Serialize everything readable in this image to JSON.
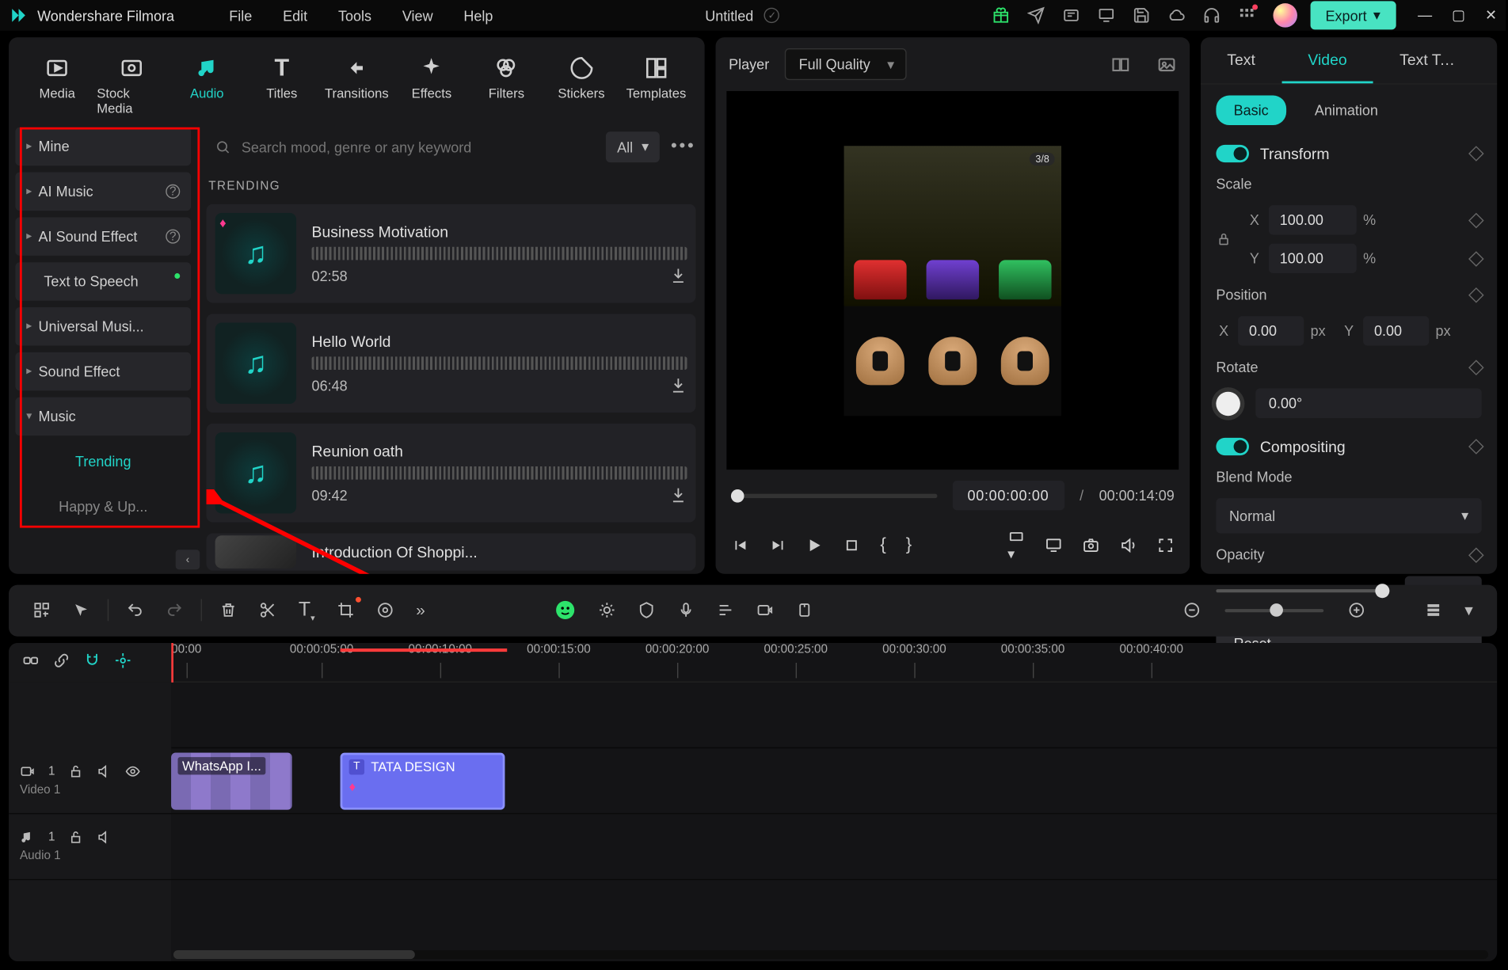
{
  "app": {
    "name": "Wondershare Filmora",
    "doc_title": "Untitled"
  },
  "menus": [
    "File",
    "Edit",
    "Tools",
    "View",
    "Help"
  ],
  "export_label": "Export",
  "media_tabs": [
    {
      "id": "media",
      "label": "Media"
    },
    {
      "id": "stock",
      "label": "Stock Media"
    },
    {
      "id": "audio",
      "label": "Audio"
    },
    {
      "id": "titles",
      "label": "Titles"
    },
    {
      "id": "trans",
      "label": "Transitions"
    },
    {
      "id": "effects",
      "label": "Effects"
    },
    {
      "id": "filters",
      "label": "Filters"
    },
    {
      "id": "stickers",
      "label": "Stickers"
    },
    {
      "id": "templates",
      "label": "Templates"
    }
  ],
  "active_media_tab": "audio",
  "sidebar": {
    "items": [
      {
        "label": "Mine",
        "has_info": false
      },
      {
        "label": "AI Music",
        "has_info": true
      },
      {
        "label": "AI Sound Effect",
        "has_info": true
      },
      {
        "label": "Text to Speech",
        "has_dot": true,
        "no_chev": true
      },
      {
        "label": "Universal Musi..."
      },
      {
        "label": "Sound Effect"
      },
      {
        "label": "Music",
        "expanded": true
      }
    ],
    "sub_active": "Trending",
    "sub_next": "Happy & Up..."
  },
  "search": {
    "placeholder": "Search mood, genre or any keyword",
    "filter_label": "All"
  },
  "section_title": "TRENDING",
  "tracks": [
    {
      "name": "Business Motivation",
      "dur": "02:58",
      "gem": true
    },
    {
      "name": "Hello World",
      "dur": "06:48"
    },
    {
      "name": "Reunion oath",
      "dur": "09:42"
    },
    {
      "name": "Introduction Of Shoppi...",
      "dur": "",
      "partial": true,
      "img": true
    }
  ],
  "player": {
    "label": "Player",
    "quality": "Full Quality",
    "badge": "3/8",
    "current": "00:00:00:00",
    "total": "00:00:14:09"
  },
  "props": {
    "tabs": [
      "Text",
      "Video",
      "Text To Speech"
    ],
    "active_tab": "Video",
    "sub_tabs": [
      "Basic",
      "Animation"
    ],
    "active_sub": "Basic",
    "transform": {
      "label": "Transform",
      "scale_label": "Scale",
      "scale_x": "100.00",
      "scale_y": "100.00",
      "scale_unit": "%",
      "pos_label": "Position",
      "pos_x": "0.00",
      "pos_y": "0.00",
      "pos_unit": "px",
      "rot_label": "Rotate",
      "rot_val": "0.00°"
    },
    "compositing": {
      "label": "Compositing"
    },
    "blend": {
      "label": "Blend Mode",
      "value": "Normal"
    },
    "opacity": {
      "label": "Opacity",
      "value": "100.00"
    },
    "reset": "Reset"
  },
  "ruler_ticks": [
    "00:00",
    "00:00:05:00",
    "00:00:10:00",
    "00:00:15:00",
    "00:00:20:00",
    "00:00:25:00",
    "00:00:30:00",
    "00:00:35:00",
    "00:00:40:00"
  ],
  "timeline": {
    "video_track": "Video 1",
    "audio_track": "Audio 1",
    "clip1": "WhatsApp I...",
    "clip2": "TATA DESIGN"
  }
}
